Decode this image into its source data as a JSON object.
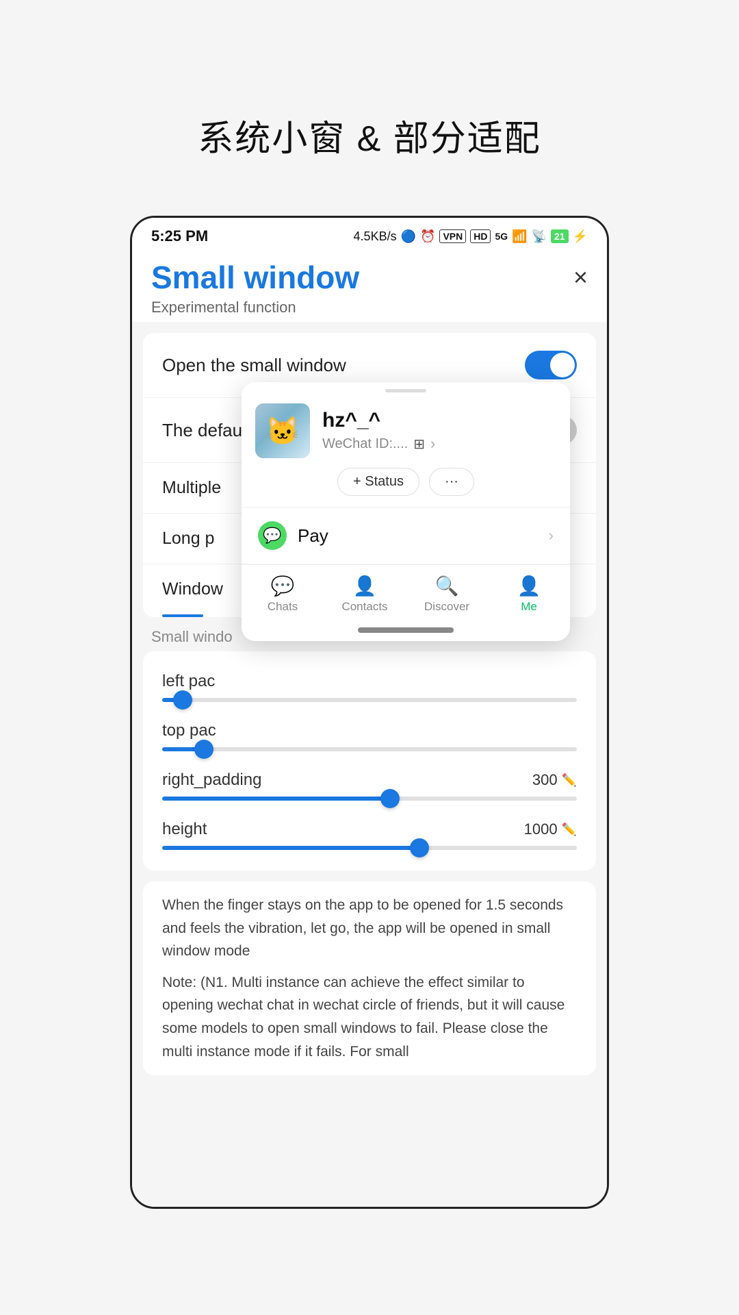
{
  "page": {
    "title": "系统小窗 & 部分适配"
  },
  "status_bar": {
    "time": "5:25 PM",
    "speed": "4.5KB/s",
    "battery": "21"
  },
  "panel": {
    "title": "Small window",
    "subtitle": "Experimental function",
    "close_label": "×"
  },
  "settings": {
    "open_small_window": {
      "label": "Open the small window",
      "enabled": true
    },
    "default_small_window": {
      "label": "The default is small window",
      "enabled": false
    },
    "multiple_label": "Multiple",
    "long_press_label": "Long p",
    "window_label": "Window"
  },
  "section": {
    "label": "Small windo"
  },
  "sliders": [
    {
      "name": "left pac",
      "value": "",
      "fill_percent": 5,
      "thumb_percent": 5
    },
    {
      "name": "top pac",
      "value": "",
      "fill_percent": 10,
      "thumb_percent": 10
    },
    {
      "name": "right_padding",
      "value": "300",
      "fill_percent": 55,
      "thumb_percent": 55
    },
    {
      "name": "height",
      "value": "1000",
      "fill_percent": 62,
      "thumb_percent": 62
    }
  ],
  "description": {
    "main": "When the finger stays on the app to be opened for 1.5 seconds and feels the vibration, let go, the app will be opened in small window mode",
    "note": "Note: (N1. Multi instance can achieve the effect similar to opening wechat chat in wechat circle of friends, but it will cause some models to open small windows to fail. Please close the multi instance mode if it fails. For small"
  },
  "wechat": {
    "profile": {
      "name": "hz^_^",
      "id_label": "WeChat ID:....",
      "avatar_emoji": "🐱"
    },
    "status_btn": "+ Status",
    "more_btn": "···",
    "pay": {
      "label": "Pay"
    },
    "nav": {
      "items": [
        {
          "label": "Chats",
          "icon": "💬",
          "active": false
        },
        {
          "label": "Contacts",
          "icon": "👤",
          "active": false
        },
        {
          "label": "Discover",
          "icon": "🧭",
          "active": false
        },
        {
          "label": "Me",
          "icon": "👤",
          "active": true
        }
      ]
    }
  }
}
